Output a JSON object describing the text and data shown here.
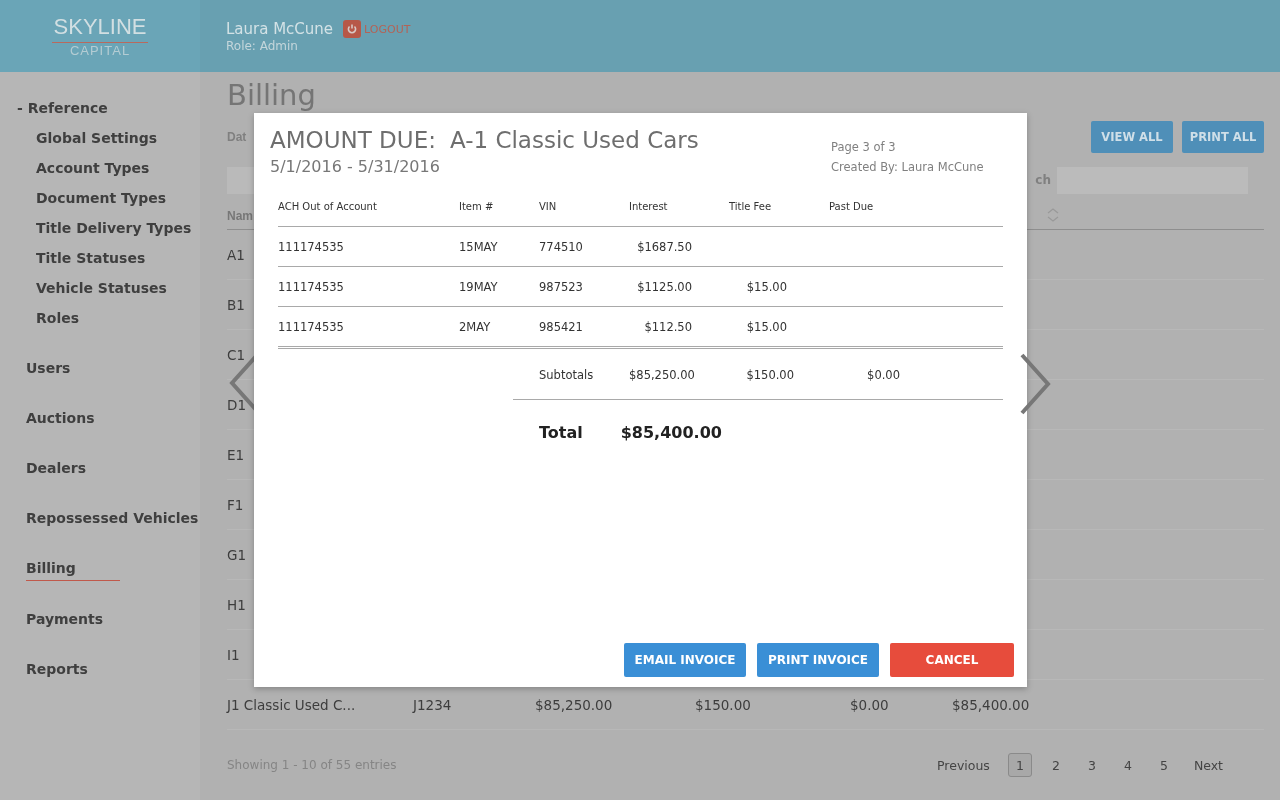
{
  "header": {
    "logo": {
      "top": "SKYLINE",
      "bottom": "CAPITAL"
    },
    "user": "Laura McCune",
    "role": "Role: Admin",
    "logout": "LOGOUT"
  },
  "sidebar": {
    "items": [
      {
        "toggle": "-",
        "label": "Reference",
        "selected": false,
        "children": [
          {
            "label": "Global Settings",
            "selected": false
          },
          {
            "label": "Account Types",
            "selected": false
          },
          {
            "label": "Document Types",
            "selected": false
          },
          {
            "label": "Title Delivery Types",
            "selected": false
          },
          {
            "label": "Title Statuses",
            "selected": false
          },
          {
            "label": "Vehicle Statuses",
            "selected": false
          },
          {
            "label": "Roles",
            "selected": false
          }
        ]
      },
      {
        "label": "Users",
        "selected": false
      },
      {
        "label": "Auctions",
        "selected": false
      },
      {
        "label": "Dealers",
        "selected": false
      },
      {
        "label": "Repossessed Vehicles",
        "selected": false
      },
      {
        "label": "Billing",
        "selected": true
      },
      {
        "label": "Payments",
        "selected": false
      },
      {
        "label": "Reports",
        "selected": false
      }
    ]
  },
  "main": {
    "title": "Billing",
    "filter_label": "Dat",
    "buttons": [
      "VIEW ALL",
      "PRINT ALL"
    ],
    "search_label": "ch",
    "table": {
      "column_1": "Nam",
      "rows": [
        [
          "A1"
        ],
        [
          "B1"
        ],
        [
          "C1"
        ],
        [
          "D1"
        ],
        [
          "E1"
        ],
        [
          "F1"
        ],
        [
          "G1"
        ],
        [
          "H1"
        ],
        [
          "I1"
        ],
        [
          "J1 Classic Used C...",
          "J1234",
          "$85,250.00",
          "$150.00",
          "$0.00",
          "$85,400.00"
        ]
      ]
    },
    "footer": {
      "info": "Showing 1 - 10 of 55 entries",
      "previous": "Previous",
      "pages": [
        {
          "label": "1",
          "selected": true
        },
        {
          "label": "2",
          "selected": false
        },
        {
          "label": "3",
          "selected": false
        },
        {
          "label": "4",
          "selected": false
        },
        {
          "label": "5",
          "selected": false
        }
      ],
      "next": "Next"
    }
  },
  "modal": {
    "title_label": "AMOUNT DUE:",
    "title_name": "A-1 Classic Used Cars",
    "date_range": "5/1/2016 - 5/31/2016",
    "page": "Page 3 of 3",
    "created_by": "Created By: Laura McCune",
    "columns": [
      "ACH Out of Account",
      "Item #",
      "VIN",
      "Interest",
      "Title Fee",
      "Past Due"
    ],
    "rows": [
      [
        "111174535",
        "15MAY",
        "774510",
        "$1687.50",
        "",
        ""
      ],
      [
        "111174535",
        "19MAY",
        "987523",
        "$1125.00",
        "$15.00",
        ""
      ],
      [
        "111174535",
        "2MAY",
        "985421",
        "$112.50",
        "$15.00",
        ""
      ]
    ],
    "subtotals": {
      "label": "Subtotals",
      "values": [
        "$85,250.00",
        "$150.00",
        "$0.00"
      ]
    },
    "total": {
      "label": "Total",
      "value": "$85,400.00"
    },
    "buttons": [
      {
        "label": "EMAIL INVOICE",
        "kind": "primary"
      },
      {
        "label": "PRINT INVOICE",
        "kind": "primary"
      },
      {
        "label": "CANCEL",
        "kind": "danger"
      }
    ]
  }
}
